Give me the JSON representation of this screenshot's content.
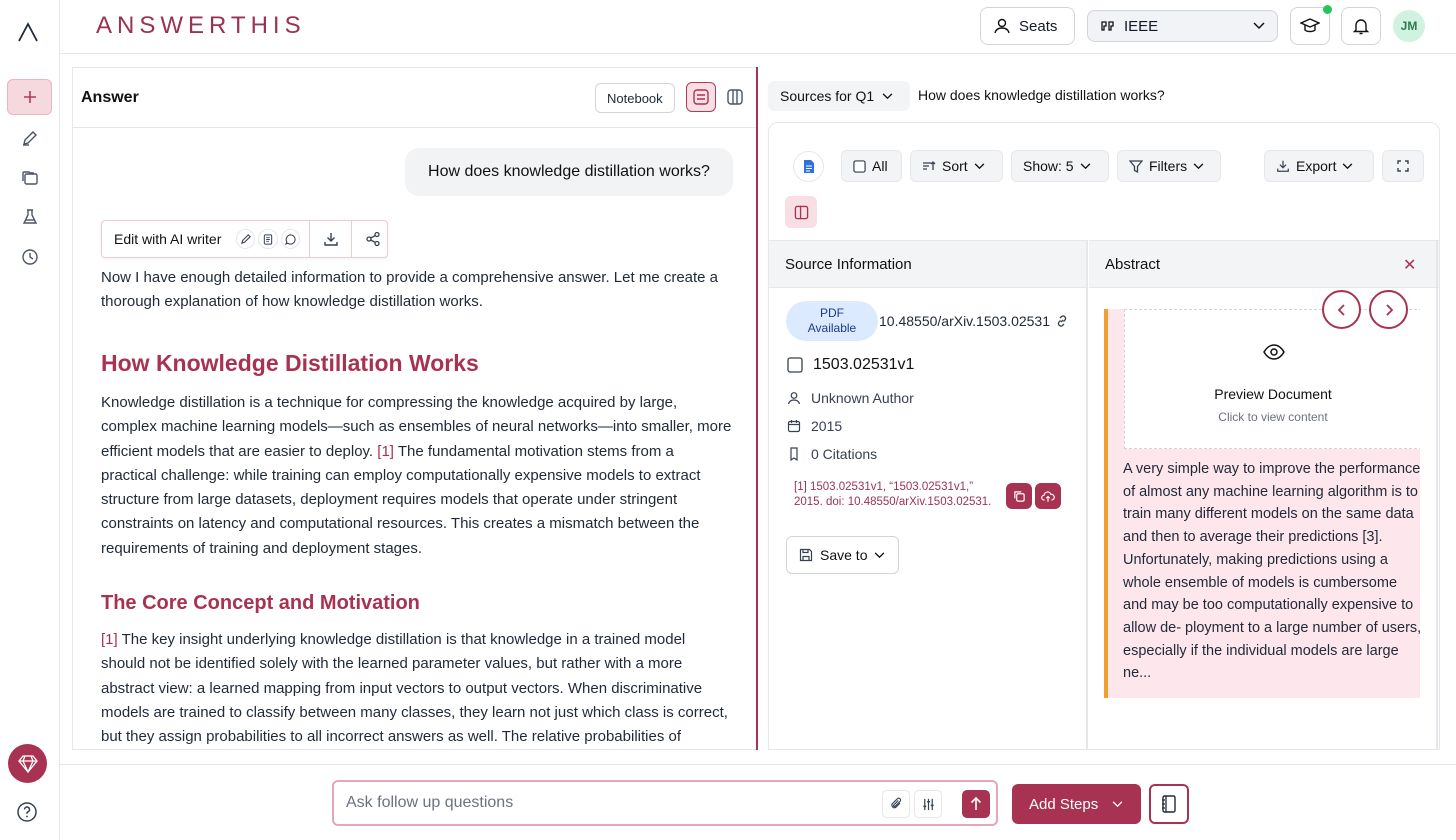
{
  "app": {
    "logo": "ANSWERTHIS"
  },
  "topbar": {
    "seats_label": "Seats",
    "citation_style": "IEEE",
    "avatar_initials": "JM"
  },
  "answer_panel": {
    "title": "Answer",
    "notebook_label": "Notebook",
    "question": "How does knowledge distillation works?",
    "ai_writer_label": "Edit with AI writer",
    "intro": "Now I have enough detailed information to provide a comprehensive answer. Let me create a thorough explanation of how knowledge distillation works.",
    "heading1": "How Knowledge Distillation Works",
    "para1_a": "Knowledge distillation is a technique for compressing the knowledge acquired by large, complex machine learning models—such as ensembles of neural networks—into smaller, more efficient models that are easier to deploy.",
    "para1_cite": "[1]",
    "para1_b": "The fundamental motivation stems from a practical challenge: while training can employ computationally expensive models to extract structure from large datasets, deployment requires models that operate under stringent constraints on latency and computational resources. This creates a mismatch between the requirements of training and deployment stages.",
    "heading2": "The Core Concept and Motivation",
    "para2_cite": "[1]",
    "para2": "The key insight underlying knowledge distillation is that knowledge in a trained model should not be identified solely with the learned parameter values, but rather with a more abstract view: a learned mapping from input vectors to output vectors. When discriminative models are trained to classify between many classes, they learn not just which class is correct, but they assign probabilities to all incorrect answers as well. The relative probabilities of incorrect answers"
  },
  "sources": {
    "selector_label": "Sources for Q1",
    "question": "How does knowledge distillation works?",
    "toolbar": {
      "all_label": "All",
      "sort_label": "Sort",
      "show_label": "Show: 5",
      "filters_label": "Filters",
      "export_label": "Export"
    },
    "columns": {
      "source_info": "Source Information",
      "abstract": "Abstract"
    },
    "item": {
      "pdf_badge_line1": "PDF",
      "pdf_badge_line2": "Available",
      "doi": "10.48550/arXiv.1503.02531",
      "id": "1503.02531v1",
      "author": "Unknown Author",
      "year": "2015",
      "citations": "0 Citations",
      "citation_text": "[1] 1503.02531v1, “1503.02531v1,” 2015. doi: 10.48550/arXiv.1503.02531.",
      "save_to_label": "Save to"
    },
    "abstract": {
      "preview_title": "Preview Document",
      "preview_sub": "Click to view content",
      "text": "A very simple way to improve the performance of almost any machine learning algorithm is to train many different models on the same data and then to average their predictions [3]. Unfortunately, making predictions using a whole ensemble of models is cumbersome and may be too computationally expensive to allow de- ployment to a large number of users, especially if the individual models are large ne..."
    }
  },
  "bottom": {
    "ask_placeholder": "Ask follow up questions",
    "add_steps_label": "Add Steps"
  },
  "colors": {
    "accent": "#a83252",
    "accent_light": "#f7dfe5",
    "abstract_bg": "#fde7ec",
    "abstract_border": "#f0a030"
  }
}
